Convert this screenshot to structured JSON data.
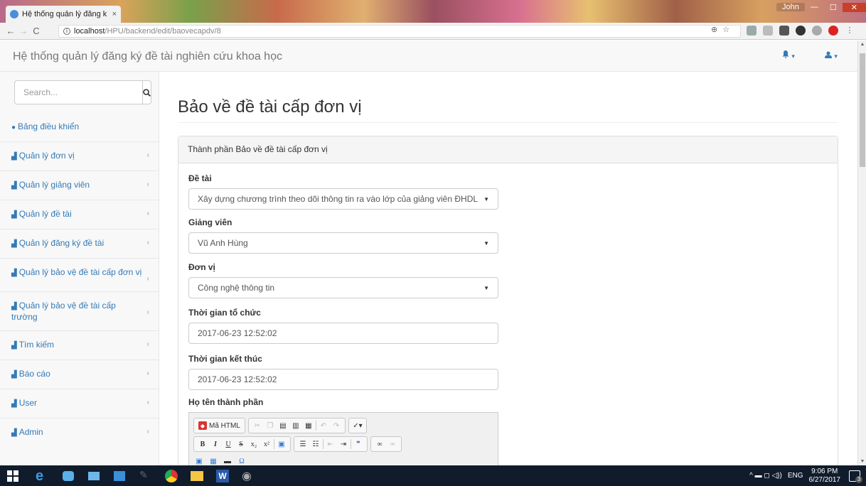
{
  "browser": {
    "tab_title": "Hệ thống quản lý đăng k",
    "tab_close": "×",
    "user_name": "John",
    "win_min": "—",
    "win_max": "☐",
    "win_close": "✕",
    "url_host": "localhost",
    "url_path": "/HPU/backend/edit/baovecapdv/8",
    "back": "←",
    "forward": "→",
    "reload": "C"
  },
  "navbar": {
    "brand": "Hệ thống quản lý đăng ký đề tài nghiên cứu khoa học",
    "bell_caret": "▾",
    "user_caret": "▾"
  },
  "sidebar": {
    "search_placeholder": "Search...",
    "items": [
      {
        "label": "Bảng điều khiển",
        "arrow": ""
      },
      {
        "label": "Quản lý đơn vị",
        "arrow": "‹"
      },
      {
        "label": "Quản lý giảng viên",
        "arrow": "‹"
      },
      {
        "label": "Quản lý đề tài",
        "arrow": "‹"
      },
      {
        "label": "Quản lý đăng ký đề tài",
        "arrow": "‹"
      },
      {
        "label": "Quản lý bảo vệ đề tài cấp đơn vị",
        "arrow": "‹"
      },
      {
        "label": "Quản lý bảo vệ đề tài cấp trường",
        "arrow": "‹"
      },
      {
        "label": "Tìm kiếm",
        "arrow": "‹"
      },
      {
        "label": "Báo cáo",
        "arrow": "‹"
      },
      {
        "label": "User",
        "arrow": "‹"
      },
      {
        "label": "Admin",
        "arrow": "‹"
      }
    ]
  },
  "main": {
    "title": "Bảo về đề tài cấp đơn vị",
    "panel_heading": "Thành phần Bảo về đề tài cấp đơn vị",
    "fields": {
      "de_tai_label": "Đề tài",
      "de_tai_value": "Xây dựng chương trình theo dõi thông tin ra vào lớp của giảng viên ĐHDL",
      "giang_vien_label": "Giảng viên",
      "giang_vien_value": "Vũ Anh Hùng",
      "don_vi_label": "Đơn vị",
      "don_vi_value": "Công nghệ thông tin",
      "tg_to_chuc_label": "Thời gian tổ chức",
      "tg_to_chuc_value": "2017-06-23 12:52:02",
      "tg_ket_thuc_label": "Thời gian kết thúc",
      "tg_ket_thuc_value": "2017-06-23 12:52:02",
      "ho_ten_label": "Họ tên thành phần"
    },
    "editor": {
      "source_label": "Mã HTML",
      "bold": "B",
      "italic": "I",
      "underline": "U",
      "strike": "S",
      "subscript": "x₂",
      "superscript": "x²",
      "quote": "❞"
    }
  },
  "taskbar": {
    "lang": "ENG",
    "time": "9:06 PM",
    "date": "6/27/2017",
    "tray_icons": "^ ▬ ◻ ◁))",
    "notif_count": "3"
  },
  "colors": {
    "link": "#337ab7",
    "taskbar": "#101c2c"
  }
}
